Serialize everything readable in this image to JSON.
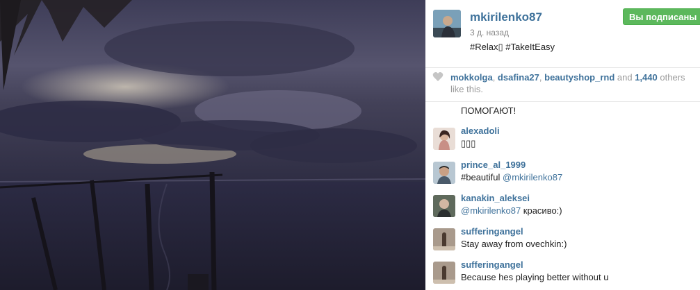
{
  "post": {
    "username": "mkirilenko87",
    "timestamp": "3 д. назад",
    "caption": "#Relax▯ #TakeItEasy",
    "follow_label": "Вы подписаны"
  },
  "likes": {
    "users": [
      "mokkolga",
      "dsafina27",
      "beautyshop_rnd"
    ],
    "and": "and",
    "count": "1,440",
    "suffix": "others like this."
  },
  "comments": {
    "partial_text": "ПОМОГАЮТ!",
    "items": [
      {
        "user": "alexadoli",
        "text": "▯▯▯"
      },
      {
        "user": "prince_al_1999",
        "text_before": "#beautiful ",
        "mention": "@mkirilenko87",
        "text_after": ""
      },
      {
        "user": "kanakin_aleksei",
        "text_before": "",
        "mention": "@mkirilenko87",
        "text_after": " красиво:)"
      },
      {
        "user": "sufferingangel",
        "text": "Stay away from ovechkin:)"
      },
      {
        "user": "sufferingangel",
        "text": "Because hes playing better without u"
      }
    ]
  },
  "colors": {
    "link": "#3f729b",
    "follow_green": "#5cb85c",
    "muted": "#999999"
  },
  "icons": {
    "like": "heart-icon"
  }
}
